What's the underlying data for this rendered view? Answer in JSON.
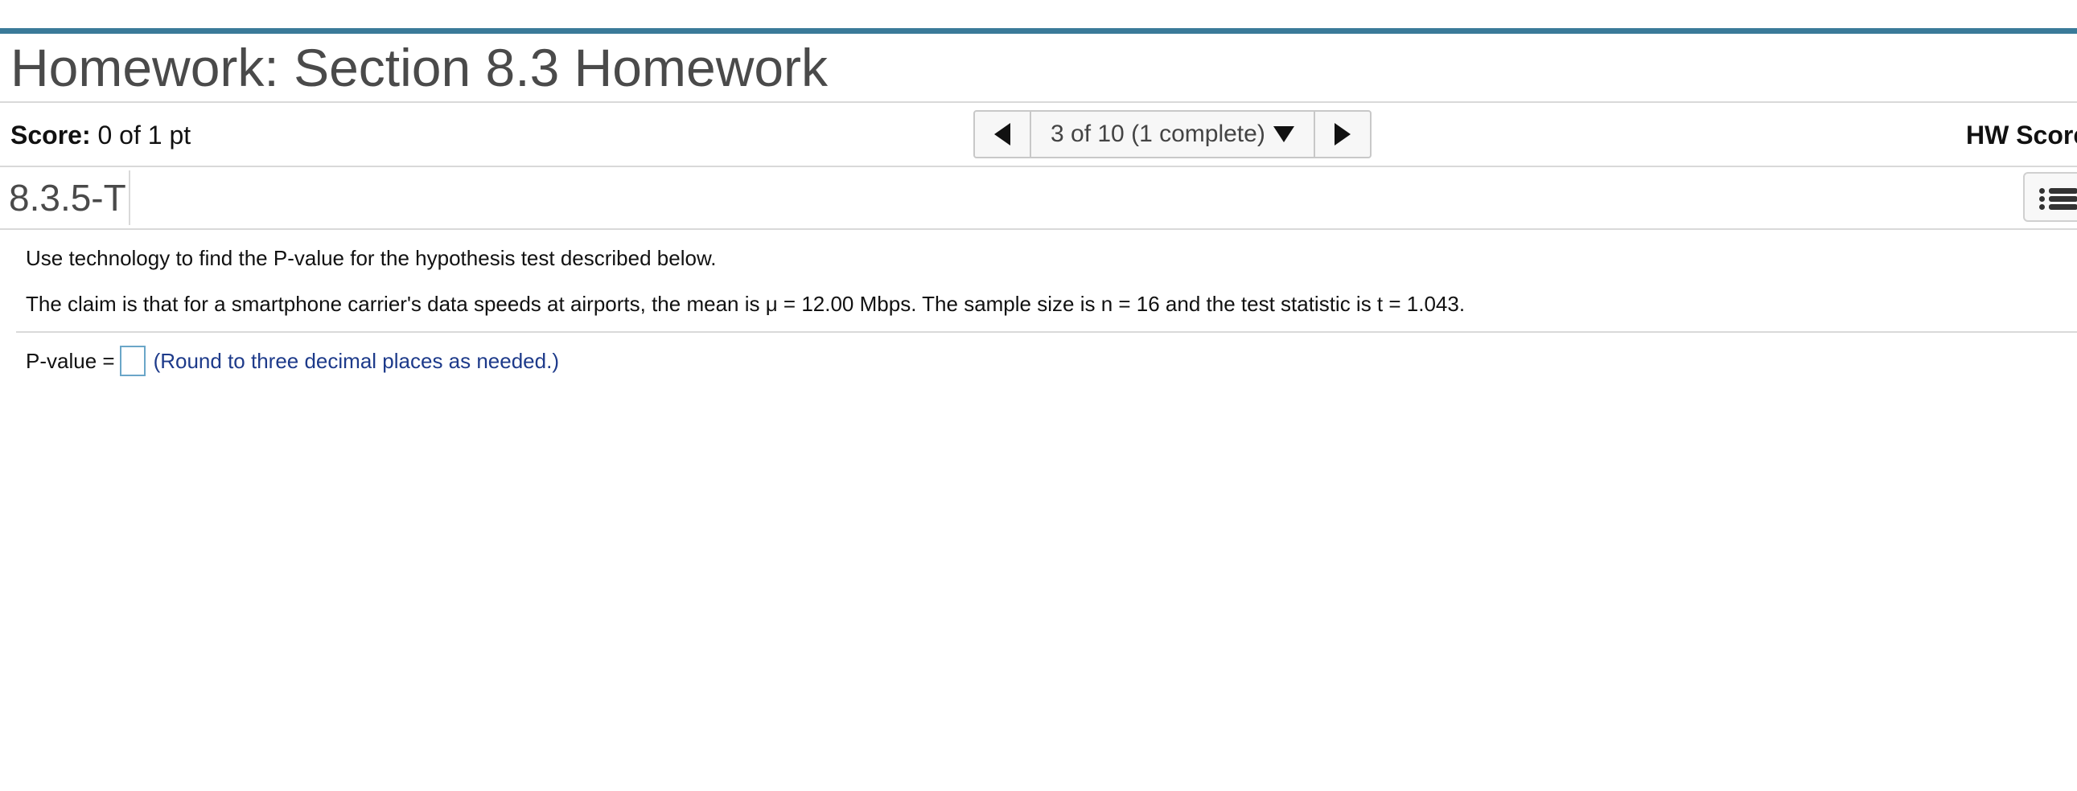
{
  "header": {
    "title": "Homework: Section 8.3 Homework"
  },
  "score_bar": {
    "score_label": "Score:",
    "score_value": " 0 of 1 pt",
    "nav_position": "3 of 10 (1 complete)",
    "hw_score_label": "HW Score"
  },
  "question": {
    "id": "8.3.5-T",
    "instructions": "Use technology to find the P-value for the hypothesis test described below.",
    "claim": "The claim is that for a smartphone carrier's data speeds at airports, the mean is μ = 12.00 Mbps. The sample size is n = 16 and the test statistic is t = 1.043.",
    "answer_label": "P-value =",
    "answer_value": "",
    "answer_hint": "(Round to three decimal places as needed.)"
  },
  "colors": {
    "accent_bar": "#3a7a99",
    "hint_text": "#1d3a8a",
    "input_border": "#6aa6c8"
  },
  "icons": {
    "prev": "triangle-left-icon",
    "next": "triangle-right-icon",
    "dropdown": "triangle-down-icon",
    "list": "list-icon"
  }
}
